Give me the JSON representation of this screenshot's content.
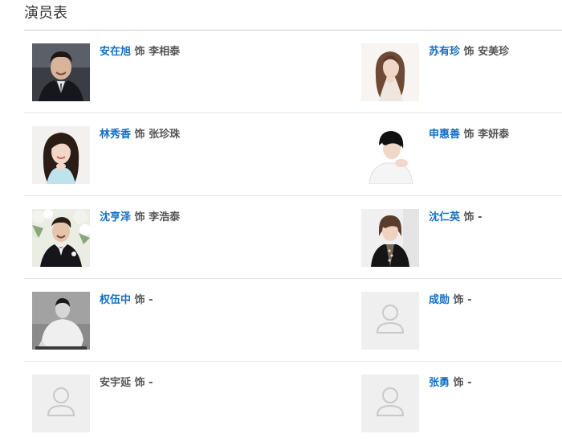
{
  "page": {
    "title": "演员表"
  },
  "cast": [
    {
      "actor": "安在旭",
      "role_label": "饰",
      "role": "李相泰",
      "actor_linked": true,
      "photo": "photo-man-suit-smiling"
    },
    {
      "actor": "苏有珍",
      "role_label": "饰",
      "role": "安美珍",
      "actor_linked": true,
      "photo": "photo-woman-long-hair"
    },
    {
      "actor": "林秀香",
      "role_label": "饰",
      "role": "张珍珠",
      "actor_linked": true,
      "photo": "photo-woman-blue-top"
    },
    {
      "actor": "申惠善",
      "role_label": "饰",
      "role": "李妍泰",
      "actor_linked": true,
      "photo": "photo-woman-short-hair"
    },
    {
      "actor": "沈亨泽",
      "role_label": "饰",
      "role": "李浩泰",
      "actor_linked": true,
      "photo": "photo-man-tuxedo-flowers"
    },
    {
      "actor": "沈仁英",
      "role_label": "饰",
      "role": "-",
      "actor_linked": true,
      "photo": "photo-woman-black-jacket"
    },
    {
      "actor": "权伍中",
      "role_label": "饰",
      "role": "-",
      "actor_linked": true,
      "photo": "photo-man-bw"
    },
    {
      "actor": "成勋",
      "role_label": "饰",
      "role": "-",
      "actor_linked": true,
      "photo": "default-avatar-icon"
    },
    {
      "actor": "安宇延",
      "role_label": "饰",
      "role": "-",
      "actor_linked": false,
      "photo": "default-avatar-icon"
    },
    {
      "actor": "张勇",
      "role_label": "饰",
      "role": "-",
      "actor_linked": true,
      "photo": "default-avatar-icon"
    }
  ],
  "colors": {
    "link": "#136ec2",
    "text": "#555555",
    "title": "#333333",
    "divider": "#e6e6e6",
    "placeholder_bg": "#efefef",
    "placeholder_icon": "#c9c9c9"
  }
}
